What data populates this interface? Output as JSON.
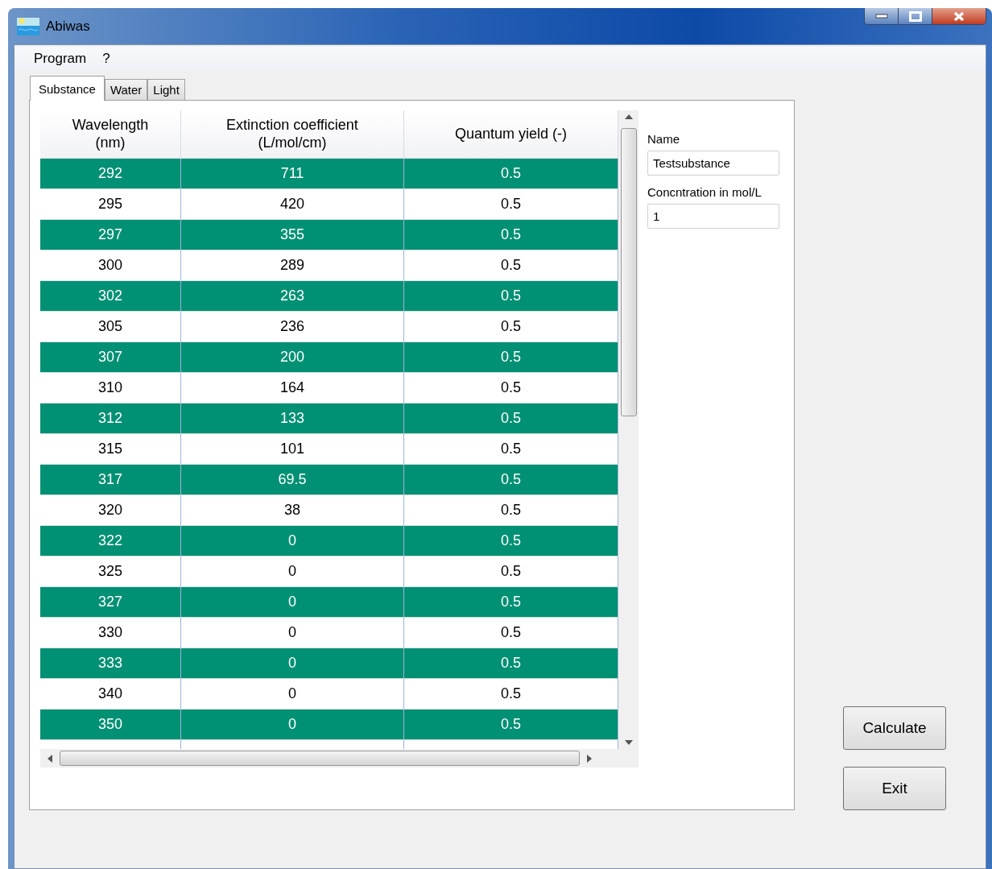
{
  "window": {
    "title": "Abiwas"
  },
  "menu": [
    "Program",
    "?"
  ],
  "tabs": [
    {
      "label": "Substance",
      "selected": true
    },
    {
      "label": "Water",
      "selected": false
    },
    {
      "label": "Light",
      "selected": false
    }
  ],
  "table": {
    "columns": [
      "Wavelength\n(nm)",
      "Extinction coefficient\n(L/mol/cm)",
      "Quantum yield (-)"
    ],
    "rows": [
      {
        "cells": [
          "292",
          "711",
          "0.5"
        ],
        "highlighted": true
      },
      {
        "cells": [
          "295",
          "420",
          "0.5"
        ],
        "highlighted": false
      },
      {
        "cells": [
          "297",
          "355",
          "0.5"
        ],
        "highlighted": true
      },
      {
        "cells": [
          "300",
          "289",
          "0.5"
        ],
        "highlighted": false
      },
      {
        "cells": [
          "302",
          "263",
          "0.5"
        ],
        "highlighted": true
      },
      {
        "cells": [
          "305",
          "236",
          "0.5"
        ],
        "highlighted": false
      },
      {
        "cells": [
          "307",
          "200",
          "0.5"
        ],
        "highlighted": true
      },
      {
        "cells": [
          "310",
          "164",
          "0.5"
        ],
        "highlighted": false
      },
      {
        "cells": [
          "312",
          "133",
          "0.5"
        ],
        "highlighted": true
      },
      {
        "cells": [
          "315",
          "101",
          "0.5"
        ],
        "highlighted": false
      },
      {
        "cells": [
          "317",
          "69.5",
          "0.5"
        ],
        "highlighted": true
      },
      {
        "cells": [
          "320",
          "38",
          "0.5"
        ],
        "highlighted": false
      },
      {
        "cells": [
          "322",
          "0",
          "0.5"
        ],
        "highlighted": true
      },
      {
        "cells": [
          "325",
          "0",
          "0.5"
        ],
        "highlighted": false
      },
      {
        "cells": [
          "327",
          "0",
          "0.5"
        ],
        "highlighted": true
      },
      {
        "cells": [
          "330",
          "0",
          "0.5"
        ],
        "highlighted": false
      },
      {
        "cells": [
          "333",
          "0",
          "0.5"
        ],
        "highlighted": true
      },
      {
        "cells": [
          "340",
          "0",
          "0.5"
        ],
        "highlighted": false
      },
      {
        "cells": [
          "350",
          "0",
          "0.5"
        ],
        "highlighted": true
      }
    ]
  },
  "fields": [
    {
      "label": "Name",
      "value": "Testsubstance"
    },
    {
      "label": "Concntration in mol/L",
      "value": "1"
    }
  ],
  "buttons": [
    "Calculate",
    "Exit"
  ]
}
